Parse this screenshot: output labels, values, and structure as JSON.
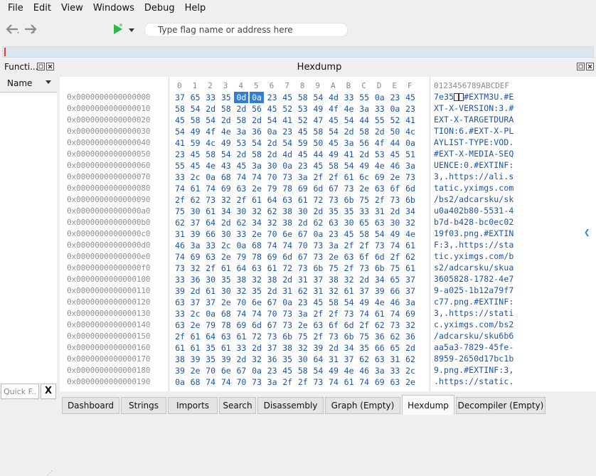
{
  "menu": [
    "File",
    "Edit",
    "View",
    "Windows",
    "Debug",
    "Help"
  ],
  "toolbar": {
    "back_icon": "back-arrow-icon",
    "forward_icon": "forward-arrow-icon",
    "run_icon": "run-icon",
    "search_placeholder": "Type flag name or address here"
  },
  "functions_panel": {
    "title": "Functi...",
    "column": "Name",
    "quick_filter_placeholder": "Quick F...",
    "clear": "X"
  },
  "hexdump": {
    "title": "Hexdump",
    "columns": [
      "0",
      "1",
      "2",
      "3",
      "4",
      "5",
      "6",
      "7",
      "8",
      "9",
      "A",
      "B",
      "C",
      "D",
      "E",
      "F"
    ],
    "ascii_header": "0123456789ABCDEF",
    "selection": {
      "row": 0,
      "start": 4,
      "end": 5
    },
    "rows": [
      {
        "addr": "0x0000000000000000",
        "bytes": "37 65 33 35 0d 0a 23 45 58 54 4d 33 55 0a 23 45",
        "ascii": "7e35..#EXTM3U.#E"
      },
      {
        "addr": "0x0000000000000010",
        "bytes": "58 54 2d 58 2d 56 45 52 53 49 4f 4e 3a 33 0a 23",
        "ascii": "XT-X-VERSION:3.#"
      },
      {
        "addr": "0x0000000000000020",
        "bytes": "45 58 54 2d 58 2d 54 41 52 47 45 54 44 55 52 41",
        "ascii": "EXT-X-TARGETDURA"
      },
      {
        "addr": "0x0000000000000030",
        "bytes": "54 49 4f 4e 3a 36 0a 23 45 58 54 2d 58 2d 50 4c",
        "ascii": "TION:6.#EXT-X-PL"
      },
      {
        "addr": "0x0000000000000040",
        "bytes": "41 59 4c 49 53 54 2d 54 59 50 45 3a 56 4f 44 0a",
        "ascii": "AYLIST-TYPE:VOD."
      },
      {
        "addr": "0x0000000000000050",
        "bytes": "23 45 58 54 2d 58 2d 4d 45 44 49 41 2d 53 45 51",
        "ascii": "#EXT-X-MEDIA-SEQ"
      },
      {
        "addr": "0x0000000000000060",
        "bytes": "55 45 4e 43 45 3a 30 0a 23 45 58 54 49 4e 46 3a",
        "ascii": "UENCE:0.#EXTINF:"
      },
      {
        "addr": "0x0000000000000070",
        "bytes": "33 2c 0a 68 74 74 70 73 3a 2f 2f 61 6c 69 2e 73",
        "ascii": "3,.https://ali.s"
      },
      {
        "addr": "0x0000000000000080",
        "bytes": "74 61 74 69 63 2e 79 78 69 6d 67 73 2e 63 6f 6d",
        "ascii": "tatic.yximgs.com"
      },
      {
        "addr": "0x0000000000000090",
        "bytes": "2f 62 73 32 2f 61 64 63 61 72 73 6b 75 2f 73 6b",
        "ascii": "/bs2/adcarsku/sk"
      },
      {
        "addr": "0x00000000000000a0",
        "bytes": "75 30 61 34 30 32 62 38 30 2d 35 35 33 31 2d 34",
        "ascii": "u0a402b80-5531-4"
      },
      {
        "addr": "0x00000000000000b0",
        "bytes": "62 37 64 2d 62 34 32 38 2d 62 63 30 65 63 30 32",
        "ascii": "b7d-b428-bc0ec02"
      },
      {
        "addr": "0x00000000000000c0",
        "bytes": "31 39 66 30 33 2e 70 6e 67 0a 23 45 58 54 49 4e",
        "ascii": "19f03.png.#EXTIN"
      },
      {
        "addr": "0x00000000000000d0",
        "bytes": "46 3a 33 2c 0a 68 74 74 70 73 3a 2f 2f 73 74 61",
        "ascii": "F:3,.https://sta"
      },
      {
        "addr": "0x00000000000000e0",
        "bytes": "74 69 63 2e 79 78 69 6d 67 73 2e 63 6f 6d 2f 62",
        "ascii": "tic.yximgs.com/b"
      },
      {
        "addr": "0x00000000000000f0",
        "bytes": "73 32 2f 61 64 63 61 72 73 6b 75 2f 73 6b 75 61",
        "ascii": "s2/adcarsku/skua"
      },
      {
        "addr": "0x0000000000000100",
        "bytes": "33 36 30 35 38 32 38 2d 31 37 38 32 2d 34 65 37",
        "ascii": "3605828-1782-4e7"
      },
      {
        "addr": "0x0000000000000110",
        "bytes": "39 2d 61 30 32 35 2d 31 62 31 32 61 37 39 66 37",
        "ascii": "9-a025-1b12a79f7"
      },
      {
        "addr": "0x0000000000000120",
        "bytes": "63 37 37 2e 70 6e 67 0a 23 45 58 54 49 4e 46 3a",
        "ascii": "c77.png.#EXTINF:"
      },
      {
        "addr": "0x0000000000000130",
        "bytes": "33 2c 0a 68 74 74 70 73 3a 2f 2f 73 74 61 74 69",
        "ascii": "3,.https://stati"
      },
      {
        "addr": "0x0000000000000140",
        "bytes": "63 2e 79 78 69 6d 67 73 2e 63 6f 6d 2f 62 73 32",
        "ascii": "c.yximgs.com/bs2"
      },
      {
        "addr": "0x0000000000000150",
        "bytes": "2f 61 64 63 61 72 73 6b 75 2f 73 6b 75 36 62 36",
        "ascii": "/adcarsku/sku6b6"
      },
      {
        "addr": "0x0000000000000160",
        "bytes": "61 61 35 61 33 2d 37 38 32 39 2d 34 35 66 65 2d",
        "ascii": "aa5a3-7829-45fe-"
      },
      {
        "addr": "0x0000000000000170",
        "bytes": "38 39 35 39 2d 32 36 35 30 64 31 37 62 63 31 62",
        "ascii": "8959-2650d17bc1b"
      },
      {
        "addr": "0x0000000000000180",
        "bytes": "39 2e 70 6e 67 0a 23 45 58 54 49 4e 46 3a 33 2c",
        "ascii": "9.png.#EXTINF:3,"
      },
      {
        "addr": "0x0000000000000190",
        "bytes": "0a 68 74 74 70 73 3a 2f 2f 73 74 61 74 69 63 2e",
        "ascii": ".https://static."
      }
    ]
  },
  "tabs": [
    {
      "label": "Dashboard",
      "active": false
    },
    {
      "label": "Strings",
      "active": false
    },
    {
      "label": "Imports",
      "active": false
    },
    {
      "label": "Search",
      "active": false
    },
    {
      "label": "Disassembly",
      "active": false
    },
    {
      "label": "Graph (Empty)",
      "active": false
    },
    {
      "label": "Hexdump",
      "active": true
    },
    {
      "label": "Decompiler (Empty)",
      "active": false
    }
  ],
  "colors": {
    "accent": "#2f7fd8",
    "hex_text": "#1d54a0",
    "address": "#8f8f8f",
    "run": "#2fb84a",
    "progress_marker": "#e23a2a"
  }
}
